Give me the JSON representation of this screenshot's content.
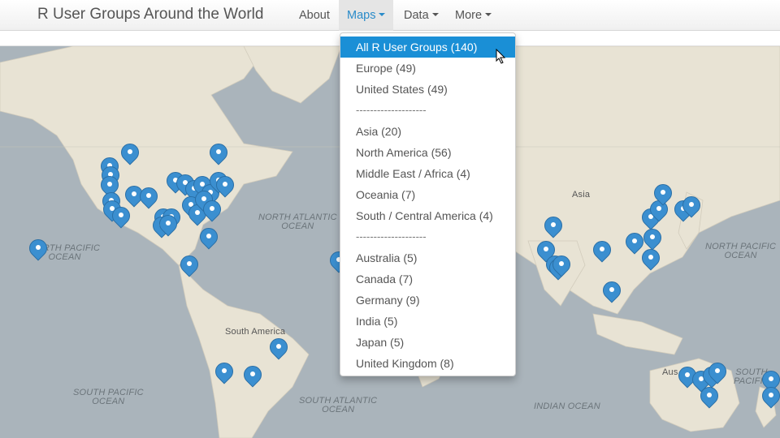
{
  "app": {
    "title": "R User Groups Around the World"
  },
  "nav": {
    "about": "About",
    "maps": "Maps",
    "data": "Data",
    "more": "More"
  },
  "dropdown": {
    "items": [
      "All R User Groups (140)",
      "Europe (49)",
      "United States (49)",
      "--------------------",
      "Asia (20)",
      "North America (56)",
      "Middle East / Africa (4)",
      "Oceania (7)",
      "South / Central America (4)",
      "--------------------",
      "Australia (5)",
      "Canada (7)",
      "Germany (9)",
      "India (5)",
      "Japan (5)",
      "United Kingdom (8)"
    ],
    "active_index": 0
  },
  "map": {
    "labels": {
      "north_atlantic": "NORTH ATLANTIC\nOCEAN",
      "north_pacific_w": "NORTH PACIFIC\nOCEAN",
      "north_pacific_e": "NORTH PACIFIC\nOCEAN",
      "south_pacific": "SOUTH PACIFIC\nOCEAN",
      "south_atlantic": "SOUTH ATLANTIC\nOCEAN",
      "indian": "INDIAN OCEAN",
      "south_pacific_e": "SOUTH PACIFIC",
      "asia": "Asia",
      "south_america": "South America",
      "australia": "Aus"
    },
    "marker_icon": "map-marker-icon",
    "colors": {
      "ocean": "#aab4bb",
      "land": "#e8e3d4",
      "marker": "#3b8fd0",
      "active": "#1a8fd6"
    }
  }
}
